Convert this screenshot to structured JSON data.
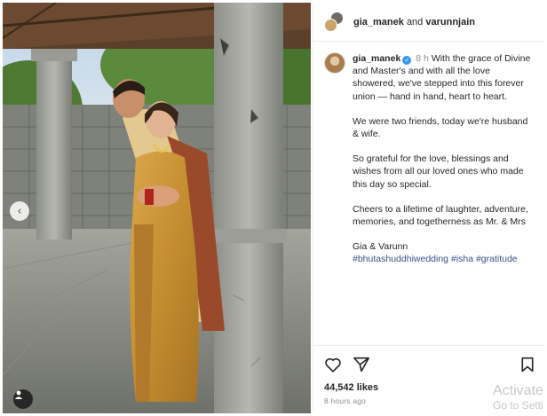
{
  "header": {
    "user1": "gia_manek",
    "conjunction": "and",
    "user2": "varunnjain"
  },
  "caption": {
    "username": "gia_manek",
    "time": "8 h",
    "paragraphs": [
      "With the grace of Divine and Master's and with all the love showered, we've stepped into this forever union — hand in hand, heart to heart.",
      "We were two friends, today we're husband & wife.",
      "So grateful for the love, blessings and wishes from all our loved ones who made this day so special.",
      "Cheers to a lifetime of laughter, adventure, memories, and togetherness as Mr. & Mrs",
      "Gia & Varunn"
    ],
    "hashtags": "#bhutashuddhiwedding #isha #gratitude"
  },
  "actions": {
    "likes": "44,542 likes",
    "posted": "8 hours ago",
    "icons": [
      "heart-icon",
      "share-icon",
      "bookmark-icon"
    ]
  },
  "watermark": {
    "title": "Activate",
    "subtitle": "Go to Setti"
  },
  "icons": {
    "carousel_prev": "chevron-left-icon",
    "tagged_people": "person-icon",
    "verified": "verified-badge-icon"
  },
  "colors": {
    "verified": "#3897f0",
    "hashtag": "#385185",
    "muted": "#8e8e8e"
  }
}
